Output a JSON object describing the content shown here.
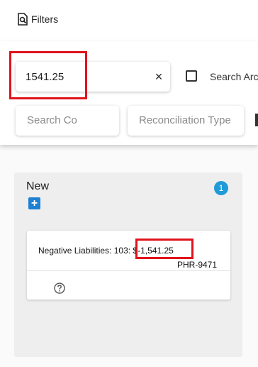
{
  "header": {
    "title": "Filters",
    "icon": "filter-search-icon"
  },
  "filters": {
    "search": {
      "value": "1541.25",
      "clear_icon": "×"
    },
    "checkbox": {
      "label": "Search Arc",
      "checked": false
    },
    "company": {
      "placeholder": "Search Co"
    },
    "reconciliation_type": {
      "placeholder": "Reconciliation Type"
    }
  },
  "column": {
    "title": "New",
    "count": "1",
    "add_icon": "+",
    "card": {
      "label_prefix": "Negative Liabilities: 103",
      "amount": ": $-1,541.25",
      "id": "PHR-9471"
    }
  },
  "colors": {
    "highlight": "#e0131c",
    "accent": "#1f9bd8",
    "add_button": "#1f7fd0"
  }
}
